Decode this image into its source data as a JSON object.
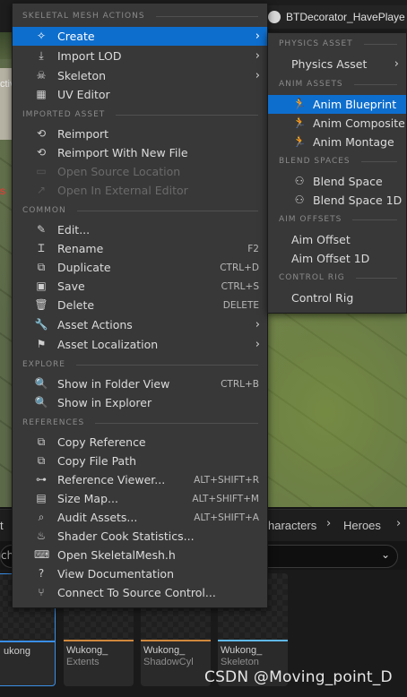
{
  "background": {
    "tab_title": "BTDecorator_HavePlaye",
    "viewport_edge_text": "ctiv",
    "viewport_red_text": "s",
    "breadcrumbs": [
      "t",
      "haracters",
      "Heroes"
    ],
    "search_stub": "ch",
    "assets": [
      {
        "name": "ukong",
        "sub": "",
        "bar": "#3a8ee6"
      },
      {
        "name": "Wukong_",
        "sub": "Extents",
        "bar": "#d0883c"
      },
      {
        "name": "Wukong_",
        "sub": "ShadowCyl",
        "bar": "#d0883c"
      },
      {
        "name": "Wukong_",
        "sub": "Skeleton",
        "bar": "#5fb8e8"
      }
    ]
  },
  "main_menu": {
    "sections": {
      "skeletal": "SKELETAL MESH ACTIONS",
      "imported": "IMPORTED ASSET",
      "common": "COMMON",
      "explore": "EXPLORE",
      "references": "REFERENCES"
    },
    "items": {
      "create": {
        "label": "Create",
        "icon": "create-icon"
      },
      "import_lod": {
        "label": "Import LOD",
        "icon": "import-icon"
      },
      "skeleton": {
        "label": "Skeleton",
        "icon": "skeleton-icon"
      },
      "uv_editor": {
        "label": "UV Editor",
        "icon": "grid-icon"
      },
      "reimport": {
        "label": "Reimport",
        "icon": "reimport-icon"
      },
      "reimport_new": {
        "label": "Reimport With New File",
        "icon": "reimport-icon"
      },
      "open_source": {
        "label": "Open Source Location",
        "icon": "folder-icon"
      },
      "open_external": {
        "label": "Open In External Editor",
        "icon": "external-icon"
      },
      "edit": {
        "label": "Edit...",
        "icon": "pencil-icon"
      },
      "rename": {
        "label": "Rename",
        "shortcut": "F2",
        "icon": "rename-icon"
      },
      "duplicate": {
        "label": "Duplicate",
        "shortcut": "CTRL+D",
        "icon": "duplicate-icon"
      },
      "save": {
        "label": "Save",
        "shortcut": "CTRL+S",
        "icon": "save-icon"
      },
      "delete": {
        "label": "Delete",
        "shortcut": "DELETE",
        "icon": "trash-icon"
      },
      "asset_actions": {
        "label": "Asset Actions",
        "icon": "wrench-icon"
      },
      "asset_localization": {
        "label": "Asset Localization",
        "icon": "flag-icon"
      },
      "folder_view": {
        "label": "Show in Folder View",
        "shortcut": "CTRL+B",
        "icon": "folder-search-icon"
      },
      "explorer": {
        "label": "Show in Explorer",
        "icon": "folder-search-icon"
      },
      "copy_ref": {
        "label": "Copy Reference",
        "icon": "copy-icon"
      },
      "copy_path": {
        "label": "Copy File Path",
        "icon": "copy-icon"
      },
      "ref_viewer": {
        "label": "Reference Viewer...",
        "shortcut": "ALT+SHIFT+R",
        "icon": "reference-viewer-icon"
      },
      "size_map": {
        "label": "Size Map...",
        "shortcut": "ALT+SHIFT+M",
        "icon": "size-map-icon"
      },
      "audit": {
        "label": "Audit Assets...",
        "shortcut": "ALT+SHIFT+A",
        "icon": "audit-icon"
      },
      "shader_cook": {
        "label": "Shader Cook Statistics...",
        "icon": "shader-icon"
      },
      "open_h": {
        "label": "Open SkeletalMesh.h",
        "icon": "code-icon"
      },
      "view_doc": {
        "label": "View Documentation",
        "icon": "help-icon"
      },
      "connect_sc": {
        "label": "Connect To Source Control...",
        "icon": "source-control-icon"
      }
    }
  },
  "sub_menu": {
    "sections": {
      "physics": "PHYSICS ASSET",
      "anim": "ANIM ASSETS",
      "blend": "BLEND SPACES",
      "aim": "AIM OFFSETS",
      "control": "CONTROL RIG"
    },
    "items": {
      "physics_asset": {
        "label": "Physics Asset"
      },
      "anim_blueprint": {
        "label": "Anim Blueprint",
        "icon": "anim-icon"
      },
      "anim_composite": {
        "label": "Anim Composite",
        "icon": "anim-icon"
      },
      "anim_montage": {
        "label": "Anim Montage",
        "icon": "anim-icon"
      },
      "blend_space": {
        "label": "Blend Space",
        "icon": "blend-icon"
      },
      "blend_space_1d": {
        "label": "Blend Space 1D",
        "icon": "blend-icon"
      },
      "aim_offset": {
        "label": "Aim Offset"
      },
      "aim_offset_1d": {
        "label": "Aim Offset 1D"
      },
      "control_rig": {
        "label": "Control Rig"
      }
    }
  },
  "watermark": "CSDN @Moving_point_D",
  "colors": {
    "highlight": "#0e6ecd",
    "menu_bg": "#383838"
  }
}
